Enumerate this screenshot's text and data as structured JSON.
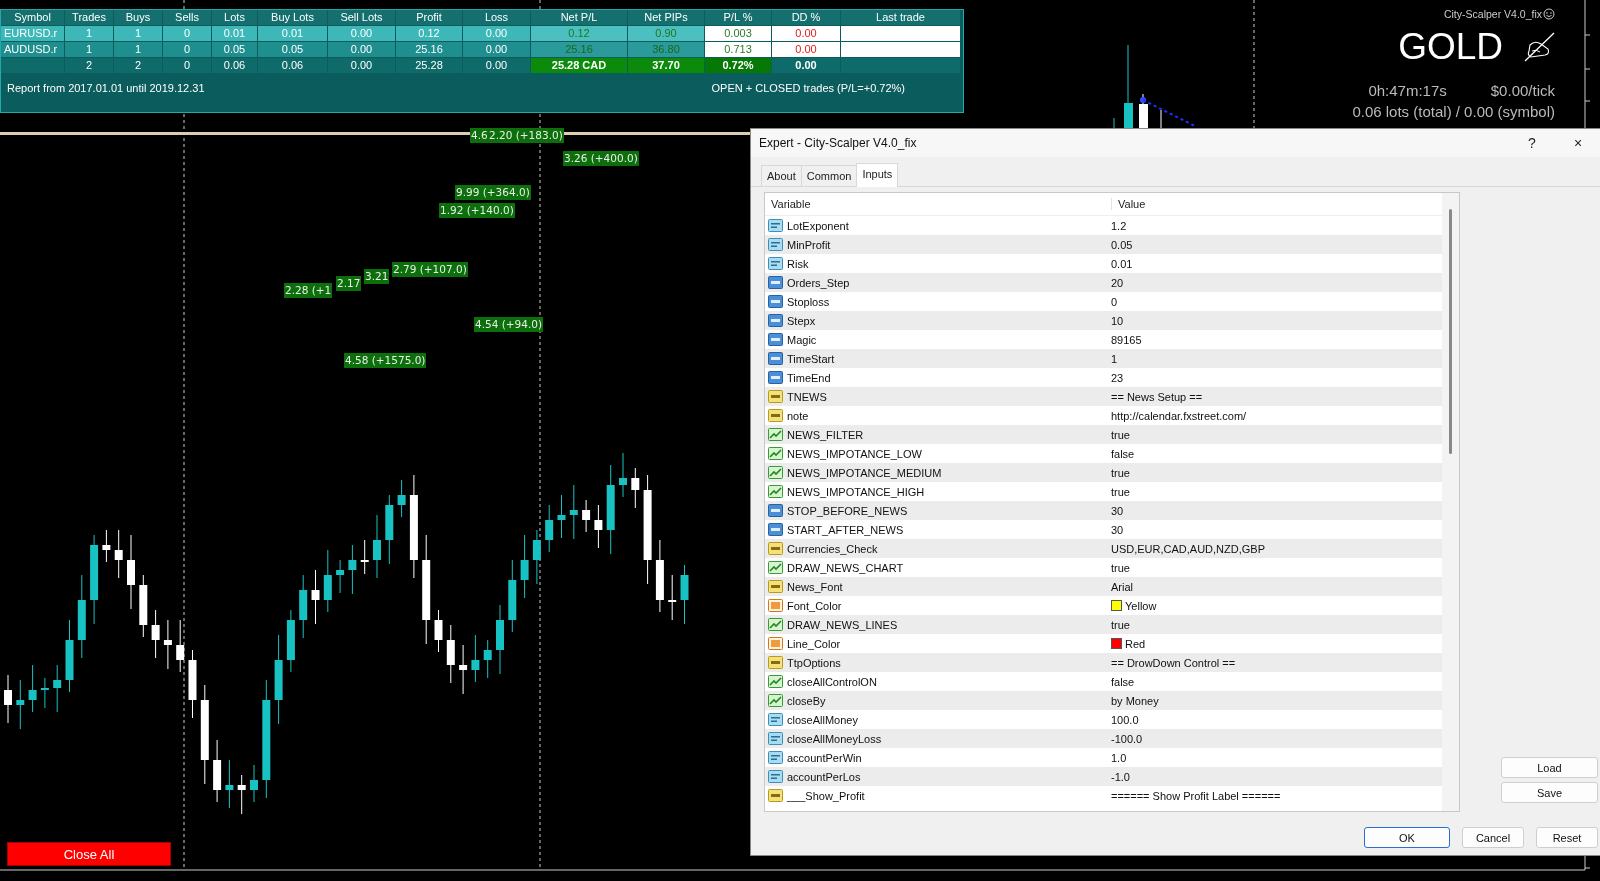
{
  "summary_table": {
    "columns": [
      "Symbol",
      "Trades",
      "Buys",
      "Sells",
      "Lots",
      "Buy Lots",
      "Sell Lots",
      "Profit",
      "Loss",
      "Net P/L",
      "Net PIPs",
      "P/L %",
      "DD %",
      "Last trade"
    ],
    "rows": [
      {
        "cells": [
          "EURUSD.r",
          "1",
          "1",
          "0",
          "0.01",
          "0.01",
          "0.00",
          "0.12",
          "0.00",
          "0.12",
          "0.90",
          "0.003",
          "0.00"
        ]
      },
      {
        "cells": [
          "AUDUSD.r",
          "1",
          "1",
          "0",
          "0.05",
          "0.05",
          "0.00",
          "25.16",
          "0.00",
          "25.16",
          "36.80",
          "0.713",
          "0.00"
        ]
      }
    ],
    "total": {
      "cells": [
        "2",
        "2",
        "0",
        "0.06",
        "0.06",
        "0.00",
        "25.28",
        "0.00",
        "25.28 CAD",
        "37.70",
        "0.72%",
        "0.00"
      ]
    },
    "footer_left": "Report from 2017.01.01 until 2019.12.31",
    "footer_right": "OPEN + CLOSED trades (P/L=+0.72%)"
  },
  "chart": {
    "profit_labels": [
      {
        "text": "4.6"
      },
      {
        "text": "2.20 (+183.0)"
      },
      {
        "text": "3.26 (+400.0)"
      },
      {
        "text": "9.99 (+364.0)"
      },
      {
        "text": "1.92 (+140.0)"
      },
      {
        "text": "2.28 (+1"
      },
      {
        "text": "2.17"
      },
      {
        "text": "3.21"
      },
      {
        "text": "2.79 (+107.0)"
      },
      {
        "text": "4.54 (+94.0)"
      },
      {
        "text": "4.58 (+1575.0)"
      }
    ],
    "close_button": "Close All"
  },
  "info_panel": {
    "ea_name": "City-Scalper V4.0_fix",
    "symbol": "GOLD",
    "timer": "0h:47m:17s",
    "tick_value": "$0.00/tick",
    "lots": "0.06 lots (total) / 0.00 (symbol)"
  },
  "dialog": {
    "title": "Expert - City-Scalper V4.0_fix",
    "help": "?",
    "close": "×",
    "tabs": [
      {
        "label": "About",
        "selected": false
      },
      {
        "label": "Common",
        "selected": false
      },
      {
        "label": "Inputs",
        "selected": true
      }
    ],
    "columns": [
      "Variable",
      "Value"
    ],
    "rows": [
      {
        "kind": "double",
        "variable": "LotExponent",
        "value": "1.2"
      },
      {
        "kind": "double",
        "variable": "MinProfit",
        "value": "0.05"
      },
      {
        "kind": "double",
        "variable": "Risk",
        "value": "0.01"
      },
      {
        "kind": "int",
        "variable": "Orders_Step",
        "value": "20"
      },
      {
        "kind": "int",
        "variable": "Stoploss",
        "value": "0"
      },
      {
        "kind": "int",
        "variable": "Stepx",
        "value": "10"
      },
      {
        "kind": "int",
        "variable": "Magic",
        "value": "89165"
      },
      {
        "kind": "int",
        "variable": "TimeStart",
        "value": "1"
      },
      {
        "kind": "int",
        "variable": "TimeEnd",
        "value": "23"
      },
      {
        "kind": "string",
        "variable": "TNEWS",
        "value": "== News Setup =="
      },
      {
        "kind": "string",
        "variable": "note",
        "value": "http://calendar.fxstreet.com/"
      },
      {
        "kind": "bool",
        "variable": "NEWS_FILTER",
        "value": "true"
      },
      {
        "kind": "bool",
        "variable": "NEWS_IMPOTANCE_LOW",
        "value": "false"
      },
      {
        "kind": "bool",
        "variable": "NEWS_IMPOTANCE_MEDIUM",
        "value": "true"
      },
      {
        "kind": "bool",
        "variable": "NEWS_IMPOTANCE_HIGH",
        "value": "true"
      },
      {
        "kind": "int",
        "variable": "STOP_BEFORE_NEWS",
        "value": "30"
      },
      {
        "kind": "int",
        "variable": "START_AFTER_NEWS",
        "value": "30"
      },
      {
        "kind": "string",
        "variable": "Currencies_Check",
        "value": "USD,EUR,CAD,AUD,NZD,GBP"
      },
      {
        "kind": "bool",
        "variable": "DRAW_NEWS_CHART",
        "value": "true"
      },
      {
        "kind": "string",
        "variable": "News_Font",
        "value": "Arial"
      },
      {
        "kind": "color",
        "variable": "Font_Color",
        "value": "Yellow",
        "color": "#ffff00"
      },
      {
        "kind": "bool",
        "variable": "DRAW_NEWS_LINES",
        "value": "true"
      },
      {
        "kind": "color",
        "variable": "Line_Color",
        "value": "Red",
        "color": "#ff0000"
      },
      {
        "kind": "string",
        "variable": "TtpOptions",
        "value": "== DrowDown Control =="
      },
      {
        "kind": "bool",
        "variable": "closeAllControlON",
        "value": "false"
      },
      {
        "kind": "bool",
        "variable": "closeBy",
        "value": "by Money"
      },
      {
        "kind": "double",
        "variable": "closeAllMoney",
        "value": "100.0"
      },
      {
        "kind": "double",
        "variable": "closeAllMoneyLoss",
        "value": "-100.0"
      },
      {
        "kind": "double",
        "variable": "accountPerWin",
        "value": "1.0"
      },
      {
        "kind": "double",
        "variable": "accountPerLos",
        "value": "-1.0"
      },
      {
        "kind": "string",
        "variable": "___Show_Profit",
        "value": "====== Show Profit Label ======"
      }
    ],
    "side_buttons": [
      "Load",
      "Save"
    ],
    "buttons": [
      {
        "label": "OK",
        "default": true
      },
      {
        "label": "Cancel",
        "default": false
      },
      {
        "label": "Reset",
        "default": false
      }
    ]
  }
}
